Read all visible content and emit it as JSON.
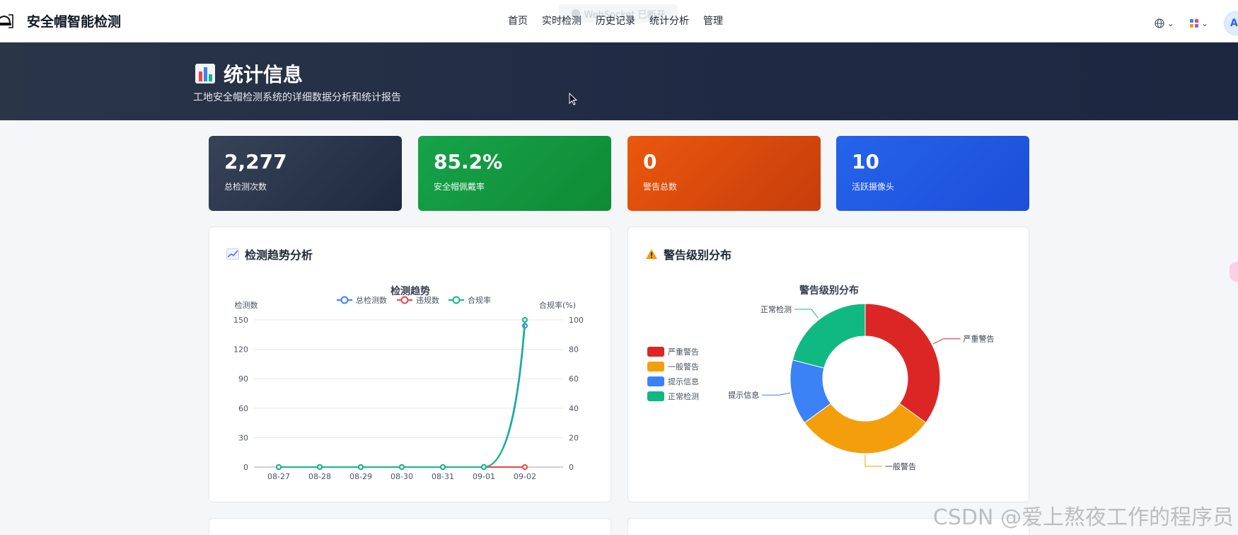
{
  "app": {
    "title": "安全帽智能检测"
  },
  "toast": {
    "text": "WebSocket 已断开"
  },
  "nav": {
    "items": [
      "首页",
      "实时检测",
      "历史记录",
      "统计分析",
      "管理"
    ]
  },
  "user": {
    "avatar_letter": "A"
  },
  "hero": {
    "title": "统计信息",
    "subtitle": "工地安全帽检测系统的详细数据分析和统计报告"
  },
  "stats": [
    {
      "value": "2,277",
      "label": "总检测次数",
      "color": "#1e2940"
    },
    {
      "value": "85.2%",
      "label": "安全帽佩戴率",
      "color": "#16a34a"
    },
    {
      "value": "0",
      "label": "警告总数",
      "color": "#ea580c"
    },
    {
      "value": "10",
      "label": "活跃摄像头",
      "color": "#2563eb"
    }
  ],
  "panels": {
    "trend_title": "检测趋势分析",
    "alert_title": "警告级别分布"
  },
  "chart_data": [
    {
      "type": "line",
      "title": "检测趋势",
      "categories": [
        "08-27",
        "08-28",
        "08-29",
        "08-30",
        "08-31",
        "09-01",
        "09-02"
      ],
      "ylabel": "检测数",
      "y2label": "合规率(%)",
      "ylim": [
        0,
        150
      ],
      "yticks": [
        0,
        30,
        60,
        90,
        120,
        150
      ],
      "y2lim": [
        0,
        100
      ],
      "y2ticks": [
        0,
        20,
        40,
        60,
        80,
        100
      ],
      "grid": true,
      "legend": "top-center",
      "series": [
        {
          "name": "总检测数",
          "axis": "left",
          "color": "#3b82f6",
          "values": [
            0,
            0,
            0,
            0,
            0,
            0,
            144
          ]
        },
        {
          "name": "违规数",
          "axis": "left",
          "color": "#ef4444",
          "values": [
            0,
            0,
            0,
            0,
            0,
            0,
            0
          ]
        },
        {
          "name": "合规率",
          "axis": "right",
          "color": "#10b981",
          "values": [
            0,
            0,
            0,
            0,
            0,
            0,
            100
          ]
        }
      ]
    },
    {
      "type": "pie",
      "title": "警告级别分布",
      "legend": "left",
      "slices": [
        {
          "name": "严重警告",
          "value": 35,
          "color": "#dc2626"
        },
        {
          "name": "一般警告",
          "value": 30,
          "color": "#f59e0b"
        },
        {
          "name": "提示信息",
          "value": 14,
          "color": "#3b82f6"
        },
        {
          "name": "正常检测",
          "value": 21,
          "color": "#10b981"
        }
      ]
    }
  ],
  "watermark": "CSDN @爱上熬夜工作的程序员"
}
